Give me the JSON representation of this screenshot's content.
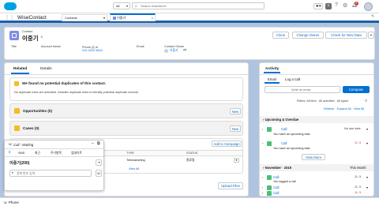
{
  "topbar": {
    "search_scope": "All",
    "search_placeholder": "Search Salesforce",
    "count_badge": "5"
  },
  "navbar": {
    "app_name": "WiseContact",
    "nav_items": [
      "Contacts",
      "이중기"
    ]
  },
  "record": {
    "object_type": "Contact",
    "name": "이중기",
    "actions": [
      "Clone",
      "Change Owner",
      "Check for New Data"
    ],
    "fields": [
      {
        "label": "Title",
        "value": ""
      },
      {
        "label": "Account Name",
        "value": ""
      },
      {
        "label": "Phone (2) ▾",
        "value": "010-4022-4824"
      },
      {
        "label": "Email",
        "value": ""
      },
      {
        "label": "Contact Owner",
        "value": "이중기"
      }
    ]
  },
  "tabs": {
    "related": "Related",
    "details": "Details"
  },
  "duplicates": {
    "title": "We found no potential duplicates of this contact.",
    "body": "No duplicate rules are activated. Activate duplicate rules to identify potential duplicate records."
  },
  "related_lists": {
    "opportunities": "Opportunities (0)",
    "cases": "Cases (0)",
    "new_label": "New",
    "add_to_campaign": "Add to Campaign",
    "col_type": "TYPE",
    "col_status": "STATUS",
    "row_type": "Telemarketing",
    "row_status": "종료됨",
    "view_all": "View All",
    "upload_files": "Upload Files"
  },
  "call_panel": {
    "title": "Call : Waiting",
    "tabs": [
      "SMS",
      "최근",
      "주기항목",
      "업데이트"
    ],
    "contact": "이중기(200)",
    "phone_placeholder": "전화 번호 입력"
  },
  "activity": {
    "title": "Activity",
    "tabs": [
      "Email",
      "Log a Call"
    ],
    "email_placeholder": "Write an email...",
    "compose": "Compose",
    "filters": "Filters: All time · All activities · All types",
    "links": "Refresh · Expand All · View All",
    "upcoming": "Upcoming & Overdue",
    "no_due": "No due date",
    "view_more": "View More",
    "month": "November · 2019",
    "this_month": "This Month",
    "items": [
      {
        "title": "Call",
        "desc": "You have an upcoming task",
        "date": "No due date",
        "group": "upcoming"
      },
      {
        "title": "Call",
        "desc": "You have an upcoming task",
        "date": "11. 5",
        "group": "upcoming"
      },
      {
        "title": "Call",
        "desc": "You logged a call",
        "date": "11. 5",
        "group": "month"
      },
      {
        "title": "Call",
        "desc": "",
        "date": "11. 5",
        "group": "month"
      },
      {
        "title": "Call",
        "desc": "You have an upcoming task",
        "date": "11. 5",
        "group": "month"
      }
    ]
  },
  "utility_bar": {
    "phone": "Phone"
  },
  "colors": {
    "brand": "#0070d2",
    "nav_bg": "#f3f2f2",
    "accent_green": "#4bc076",
    "contact_icon": "#7f8de1",
    "list_icon": "#f4bc25"
  }
}
